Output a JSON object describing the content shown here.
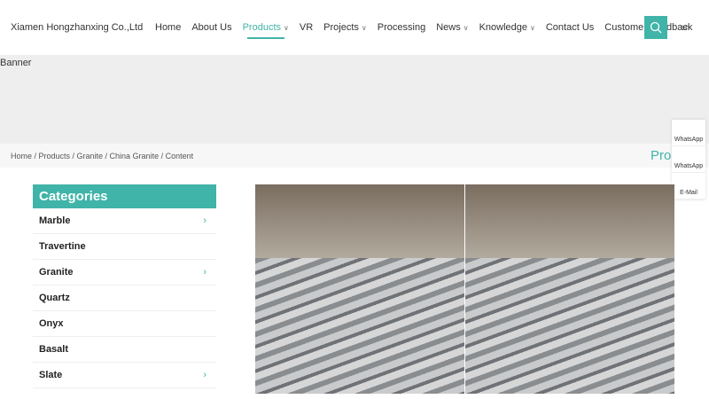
{
  "header": {
    "logo": "Xiamen Hongzhanxing Co.,Ltd",
    "nav": [
      {
        "label": "Home"
      },
      {
        "label": "About Us"
      },
      {
        "label": "Products",
        "dropdown": true,
        "active": true
      },
      {
        "label": "VR"
      },
      {
        "label": "Projects",
        "dropdown": true
      },
      {
        "label": "Processing"
      },
      {
        "label": "News",
        "dropdown": true
      },
      {
        "label": "Knowledge",
        "dropdown": true
      },
      {
        "label": "Contact Us"
      },
      {
        "label": "Customer Feedback"
      }
    ],
    "lang": "en",
    "accent": "#40b4a8"
  },
  "banner": {
    "label": "Banner"
  },
  "breadcrumb": {
    "text": "Home / Products / Granite / China Granite / Content",
    "title": "Prod"
  },
  "side_contact": [
    "WhatsApp",
    "WhatsApp",
    "E-Mail"
  ],
  "categories": {
    "title": "Categories",
    "items": [
      {
        "label": "Marble",
        "sub": true
      },
      {
        "label": "Travertine",
        "sub": false
      },
      {
        "label": "Granite",
        "sub": true
      },
      {
        "label": "Quartz",
        "sub": false
      },
      {
        "label": "Onyx",
        "sub": false
      },
      {
        "label": "Basalt",
        "sub": false
      },
      {
        "label": "Slate",
        "sub": true
      }
    ]
  }
}
